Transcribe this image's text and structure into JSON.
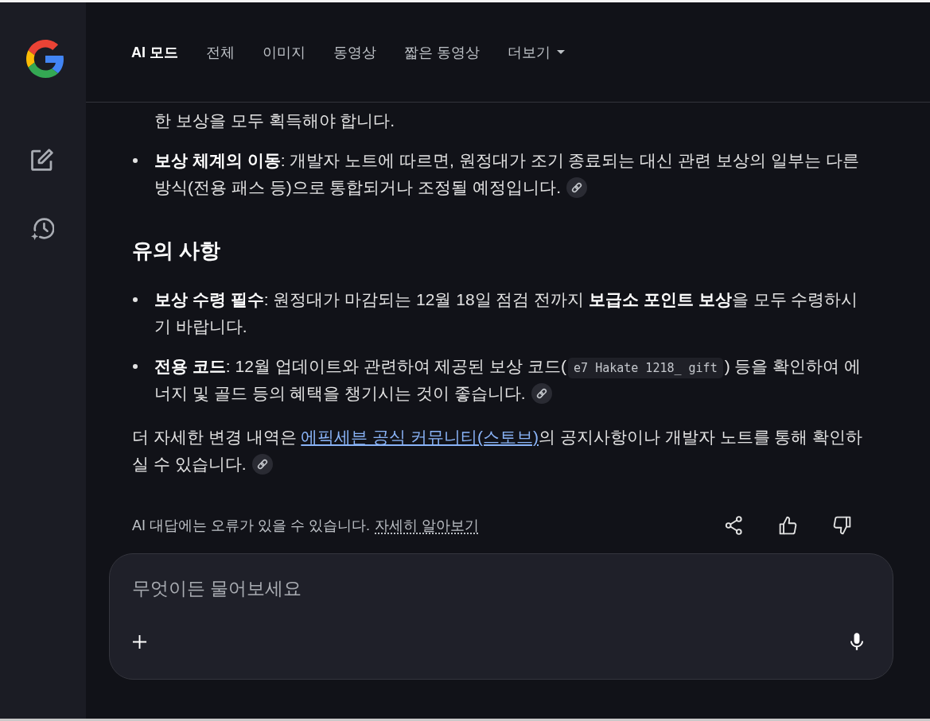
{
  "header": {
    "tabs": [
      {
        "label": "AI 모드",
        "kind": "tab",
        "selected": true
      },
      {
        "label": "전체",
        "kind": "tab",
        "selected": false
      },
      {
        "label": "이미지",
        "kind": "tab",
        "selected": false
      },
      {
        "label": "동영상",
        "kind": "tab",
        "selected": false
      },
      {
        "label": "짧은 동영상",
        "kind": "tab",
        "selected": false
      },
      {
        "label": "더보기",
        "kind": "menu",
        "selected": false
      }
    ]
  },
  "answer": {
    "blocks": [
      {
        "kind": "continuation",
        "segments": [
          {
            "kind": "text",
            "text": "한 보상을 모두 획득해야 합니다."
          }
        ],
        "source_link": false
      },
      {
        "kind": "bullet",
        "segments": [
          {
            "kind": "text",
            "text": "**보상 체계의 이동**: 개발자 노트에 따르면, 원정대가 조기 종료되는 대신 관련 보상의 일부는 다른 방식(전용 패스 등)으로 통합되거나 조정될 예정입니다."
          }
        ],
        "source_link": true
      },
      {
        "kind": "heading",
        "text": "유의 사항"
      },
      {
        "kind": "bullet",
        "segments": [
          {
            "kind": "text",
            "text": "**보상 수령 필수**: 원정대가 마감되는 12월 18일 점검 전까지 **보급소 포인트 보상**을 모두 수령하시기 바랍니다."
          }
        ],
        "source_link": false
      },
      {
        "kind": "bullet",
        "segments": [
          {
            "kind": "text",
            "text": "**전용 코드**: 12월 업데이트와 관련하여 제공된 보상 코드("
          },
          {
            "kind": "code",
            "text": "e7 Hakate 1218_ gift"
          },
          {
            "kind": "text",
            "text": ") 등을 확인하여 에너지 및 골드 등의 혜택을 챙기시는 것이 좋습니다."
          }
        ],
        "source_link": true
      },
      {
        "kind": "paragraph",
        "segments": [
          {
            "kind": "text",
            "text": "더 자세한 변경 내역은 "
          },
          {
            "kind": "link",
            "text": "에픽세븐 공식 커뮤니티(스토브)"
          },
          {
            "kind": "text",
            "text": "의 공지사항이나 개발자 노트를 통해 확인하실 수 있습니다."
          }
        ],
        "source_link": true
      }
    ]
  },
  "disclaimer": {
    "text": "AI 대답에는 오류가 있을 수 있습니다.",
    "link": "자세히 알아보기"
  },
  "composer": {
    "placeholder": "무엇이든 물어보세요"
  }
}
